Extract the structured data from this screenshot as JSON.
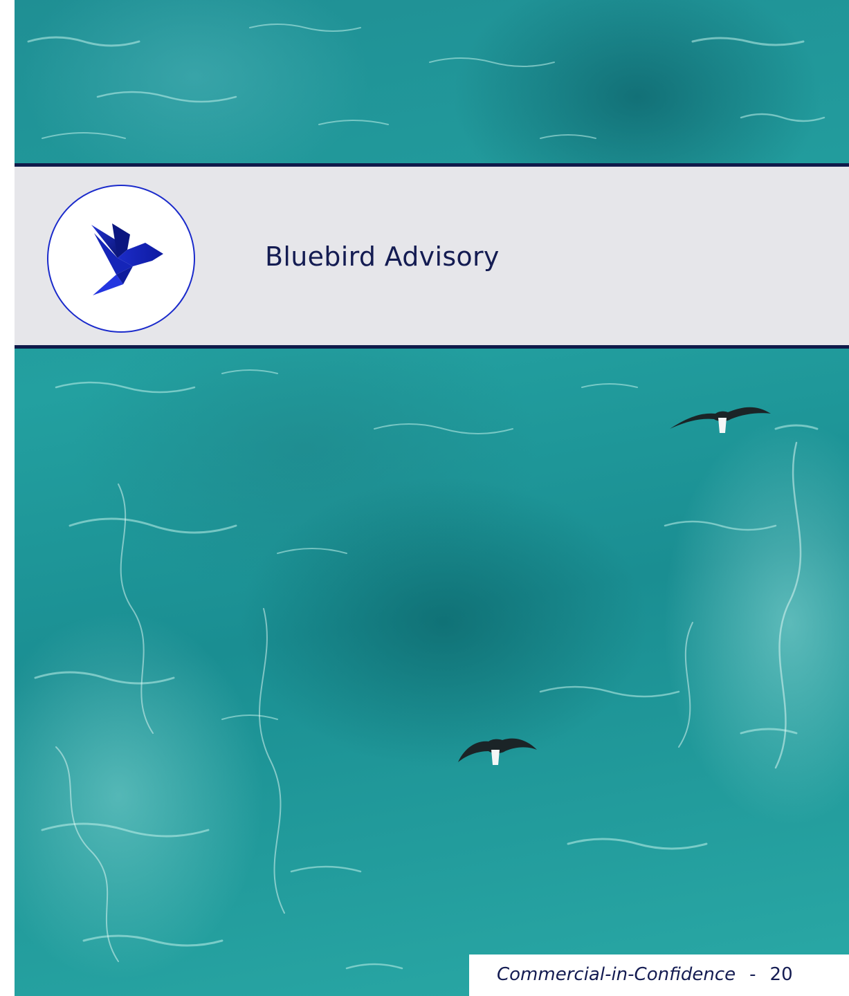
{
  "brand": {
    "name": "Bluebird Advisory",
    "logo_icon": "bluebird-logo-icon",
    "colors": {
      "navy": "#141c52",
      "royal_blue": "#1a2acb",
      "band_grey": "#e6e6ea",
      "ocean_teal": "#1f9a9c"
    }
  },
  "background": {
    "subject": "aerial ocean water",
    "birds": [
      "seagull-icon",
      "seagull-icon"
    ]
  },
  "footer": {
    "classification": "Commercial-in-Confidence",
    "separator": "-",
    "page_number": "20"
  }
}
